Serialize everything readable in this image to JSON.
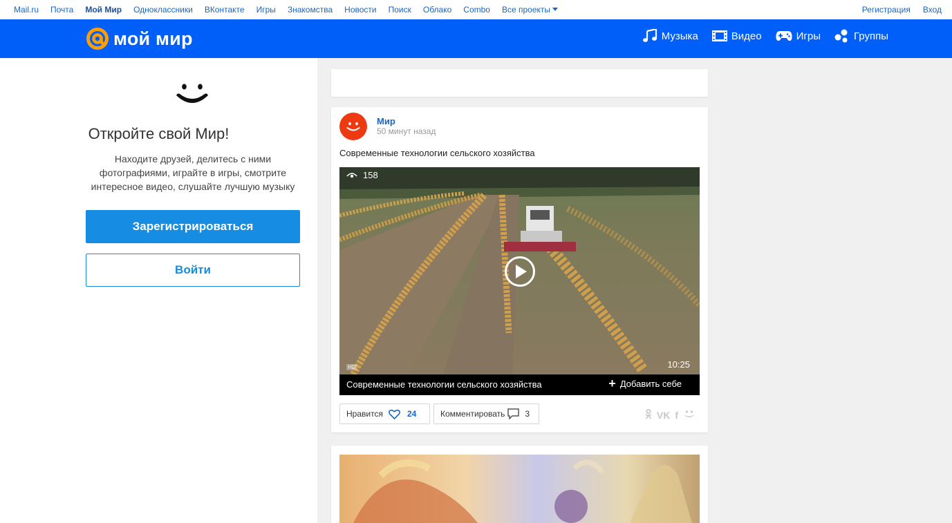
{
  "topnav": {
    "links": [
      "Mail.ru",
      "Почта",
      "Мой Мир",
      "Одноклассники",
      "ВКонтакте",
      "Игры",
      "Знакомства",
      "Новости",
      "Поиск",
      "Облако",
      "Combo",
      "Все проекты"
    ],
    "register": "Регистрация",
    "login": "Вход"
  },
  "header": {
    "logo": "мой мир",
    "nav": {
      "music": "Музыка",
      "video": "Видео",
      "games": "Игры",
      "groups": "Группы"
    }
  },
  "promo": {
    "title": "Откройте свой Мир!",
    "text": "Находите друзей, делитесь с ними фотографиями, играйте в игры, смотрите интересное видео, слушайте лучшую музыку",
    "register_button": "Зарегистрироваться",
    "login_button": "Войти"
  },
  "post": {
    "author": "Мир",
    "time": "50 минут назад",
    "text": "Современные технологии сельского хозяйства",
    "video": {
      "views": "158",
      "duration": "10:25",
      "quality": "HD",
      "title": "Современные технологии сельского хозяйства",
      "add_label": "Добавить себе"
    },
    "like_label": "Нравится",
    "like_count": "24",
    "comment_label": "Комментировать",
    "comment_count": "3",
    "share_icons": [
      "ok-icon",
      "vk-icon",
      "facebook-icon",
      "moimir-icon"
    ]
  },
  "colors": {
    "brand_blue": "#005ff9",
    "button_blue": "#168de2",
    "link_blue": "#1a65c0",
    "avatar_red": "#ee3a12",
    "logo_orange": "#ff9e00"
  }
}
